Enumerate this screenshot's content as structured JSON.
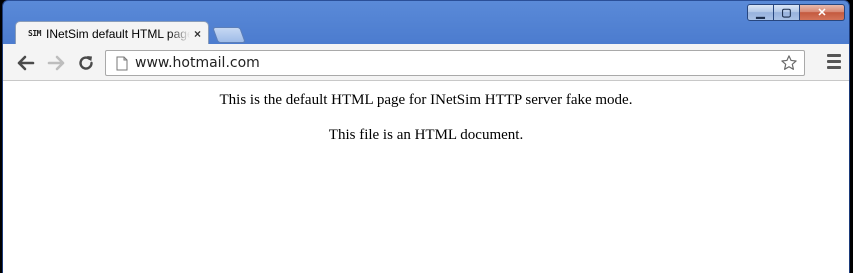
{
  "tab": {
    "favicon_text": "SIM",
    "title": "INetSim default HTML page",
    "close_glyph": "×"
  },
  "window_controls": {
    "minimize_glyph": "▁",
    "maximize_glyph": "▢",
    "close_glyph": "✕"
  },
  "toolbar": {
    "url": "www.hotmail.com",
    "back_icon": "arrow-left-icon",
    "forward_icon": "arrow-right-icon",
    "reload_icon": "reload-icon",
    "star_icon": "star-icon",
    "menu_icon": "hamburger-menu-icon"
  },
  "page": {
    "line1": "This is the default HTML page for INetSim HTTP server fake mode.",
    "line2": "This file is an HTML document."
  },
  "colors": {
    "frame": "#3f6fc6",
    "toolbar": "#f4f4f4",
    "content_bg": "#ffffff"
  }
}
